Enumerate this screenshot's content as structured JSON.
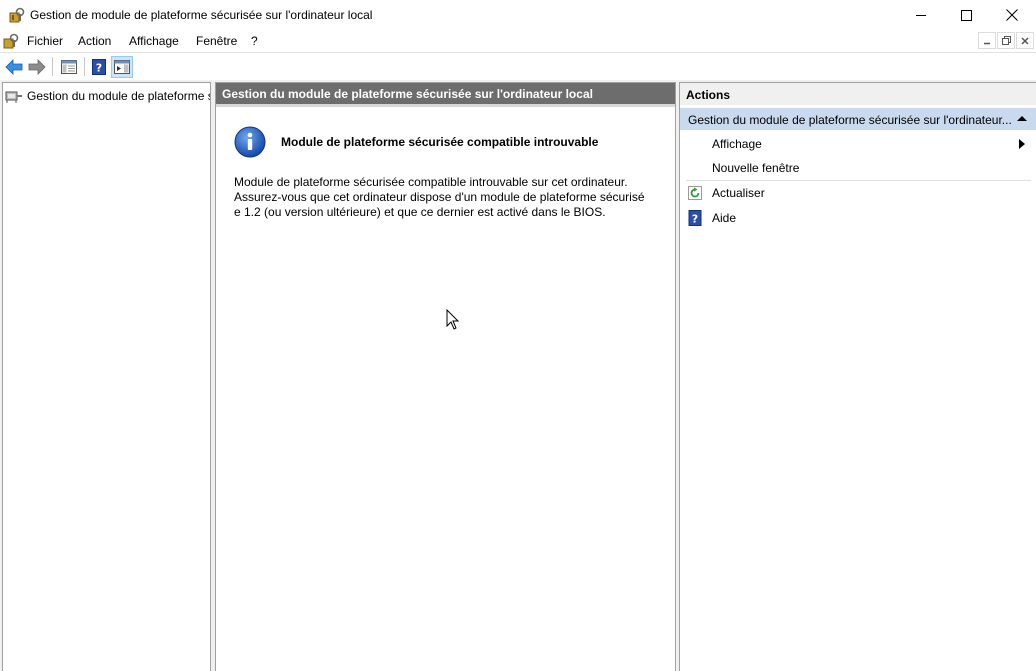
{
  "window": {
    "title": "Gestion de module de plateforme sécurisée sur l'ordinateur local"
  },
  "menubar": {
    "items": [
      "Fichier",
      "Action",
      "Affichage",
      "Fenêtre",
      "?"
    ]
  },
  "toolbar": {
    "buttons": [
      "back-arrow-icon",
      "forward-arrow-icon",
      "show-hide-console-tree-icon",
      "help-icon",
      "show-hide-action-pane-icon"
    ]
  },
  "tree": {
    "root_label": "Gestion du module de plateforme s"
  },
  "center": {
    "header": "Gestion du module de plateforme sécurisée sur l'ordinateur local",
    "info_title": "Module de plateforme sécurisée compatible introuvable",
    "body_lines": [
      "Module de plateforme sécurisée compatible introuvable sur cet ordinateur.",
      "Assurez-vous que cet ordinateur dispose d'un module de plateforme sécurisé",
      "e 1.2 (ou version ultérieure) et que ce dernier est activé dans le BIOS."
    ]
  },
  "actions": {
    "header": "Actions",
    "section_title": "Gestion du module de plateforme sécurisée sur l'ordinateur...",
    "items": [
      {
        "label": "Affichage",
        "icon": "",
        "has_submenu": true
      },
      {
        "label": "Nouvelle fenêtre",
        "icon": "",
        "has_submenu": false
      },
      {
        "label": "Actualiser",
        "icon": "refresh-icon",
        "has_submenu": false
      },
      {
        "label": "Aide",
        "icon": "help-icon",
        "has_submenu": false
      }
    ]
  },
  "colors": {
    "center_header_bg": "#6d6d6d",
    "actions_section_bg": "#c9d9ee",
    "accent_blue": "#2b6cc4"
  }
}
